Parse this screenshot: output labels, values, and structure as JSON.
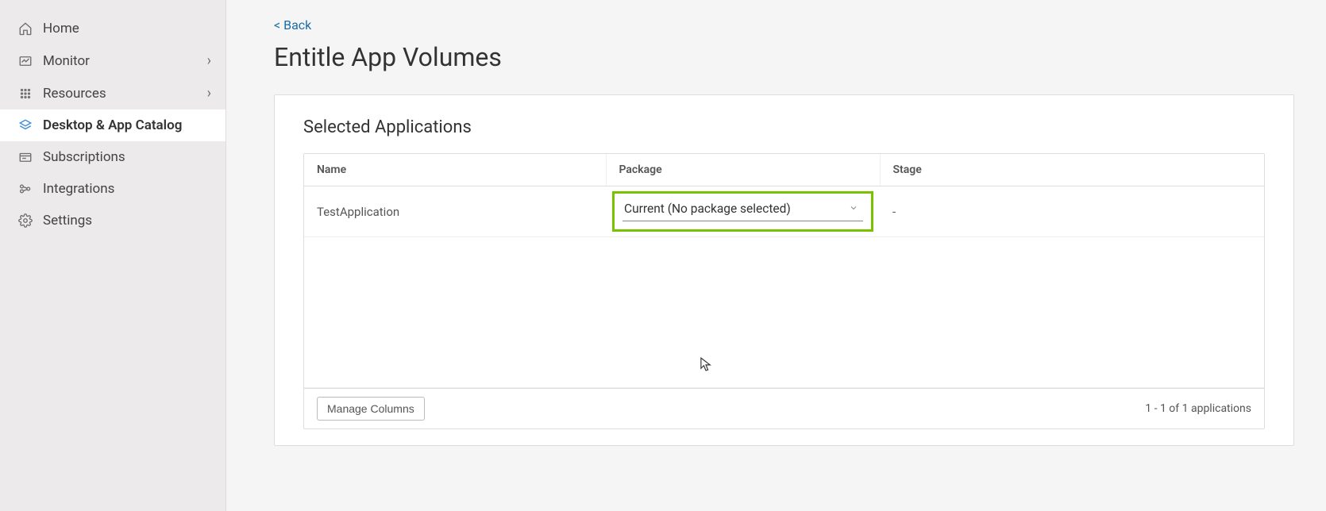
{
  "sidebar": {
    "items": [
      {
        "label": "Home",
        "icon": "home-icon",
        "expandable": false,
        "active": false
      },
      {
        "label": "Monitor",
        "icon": "monitor-icon",
        "expandable": true,
        "active": false
      },
      {
        "label": "Resources",
        "icon": "resources-icon",
        "expandable": true,
        "active": false
      },
      {
        "label": "Desktop & App Catalog",
        "icon": "catalog-icon",
        "expandable": false,
        "active": true
      },
      {
        "label": "Subscriptions",
        "icon": "subscriptions-icon",
        "expandable": false,
        "active": false
      },
      {
        "label": "Integrations",
        "icon": "integrations-icon",
        "expandable": false,
        "active": false
      },
      {
        "label": "Settings",
        "icon": "settings-icon",
        "expandable": false,
        "active": false
      }
    ]
  },
  "header": {
    "back_text": "< Back",
    "page_title": "Entitle App Volumes"
  },
  "card": {
    "title": "Selected Applications",
    "columns": {
      "name": "Name",
      "package": "Package",
      "stage": "Stage"
    },
    "rows": [
      {
        "name": "TestApplication",
        "package": "Current (No package selected)",
        "stage": "-"
      }
    ],
    "manage_columns_label": "Manage Columns",
    "footer_status": "1 - 1 of 1 applications"
  }
}
